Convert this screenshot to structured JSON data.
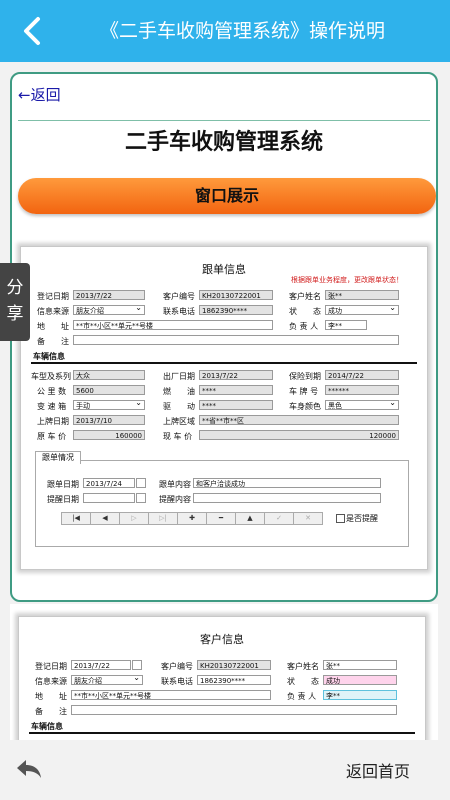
{
  "topbar": {
    "title": "《二手车收购管理系统》操作说明",
    "back_icon": "chevron-left-icon"
  },
  "article": {
    "return_link": "←返回",
    "title": "二手车收购管理系统",
    "section_button": "窗口展示"
  },
  "share": {
    "label": "分享"
  },
  "bottom": {
    "back_icon": "reply-icon",
    "home": "返回首页"
  },
  "screenshot1": {
    "title": "跟单信息",
    "hint": "根据跟单业务程度，更改跟单状态！",
    "labels": {
      "reg_date": "登记日期",
      "cust_no": "客户编号",
      "cust_name": "客户姓名",
      "info_src": "信息来源",
      "phone": "联系电话",
      "status": "状　　态",
      "address": "地　　址",
      "owner": "负 责 人",
      "remark": "备　　注",
      "vehicle": "车辆信息",
      "model": "车型及系列",
      "factory_date": "出厂日期",
      "insure_date": "保险到期",
      "mileage": "公 里 数",
      "fuel": "燃　　油",
      "plate": "车 牌 号",
      "gearbox": "变 速 箱",
      "drive": "驱　　动",
      "color": "车身颜色",
      "plate_date": "上牌日期",
      "plate_area": "上牌区域",
      "orig_price": "原 车 价",
      "cur_price": "现 车 价",
      "follow_tab": "跟单情况",
      "follow_date": "跟单日期",
      "follow_content": "跟单内容",
      "remind_date": "提醒日期",
      "remind_content": "提醒内容",
      "is_remind": "是否提醒"
    },
    "values": {
      "reg_date": "2013/7/22",
      "cust_no": "KH20130722001",
      "cust_name": "张**",
      "info_src": "朋友介绍",
      "phone": "1862390****",
      "status": "成功",
      "address": "**市**小区**单元**号楼",
      "owner": "李**",
      "remark": "",
      "model": "大众",
      "factory_date": "2013/7/22",
      "insure_date": "2014/7/22",
      "mileage": "5600",
      "fuel": "****",
      "plate": "******",
      "gearbox": "手动",
      "drive": "****",
      "color": "黑色",
      "plate_date": "2013/7/10",
      "plate_area": "**省**市**区",
      "orig_price": "160000",
      "cur_price": "120000",
      "follow_date": "2013/7/24",
      "follow_content": "和客户洽谈成功",
      "remind_date": "",
      "remind_content": ""
    },
    "nav": [
      "|◀",
      "◀",
      "▷",
      "▷|",
      "✚",
      "━",
      "▲",
      "✓",
      "✕"
    ]
  },
  "screenshot2": {
    "title": "客户信息",
    "labels": {
      "reg_date": "登记日期",
      "cust_no": "客户编号",
      "cust_name": "客户姓名",
      "info_src": "信息来源",
      "phone": "联系电话",
      "status": "状　　态",
      "address": "地　　址",
      "owner": "负 责 人",
      "remark": "备　　注",
      "vehicle": "车辆信息"
    },
    "values": {
      "reg_date": "2013/7/22",
      "cust_no": "KH20130722001",
      "cust_name": "张**",
      "info_src": "朋友介绍",
      "phone": "1862390****",
      "status": "成功",
      "address": "**市**小区**单元**号楼",
      "owner": "李**"
    }
  },
  "colors": {
    "topbar": "#2fb2eb",
    "button": "#f26410",
    "hint": "#d21e1e",
    "border": "#3f9b83"
  }
}
